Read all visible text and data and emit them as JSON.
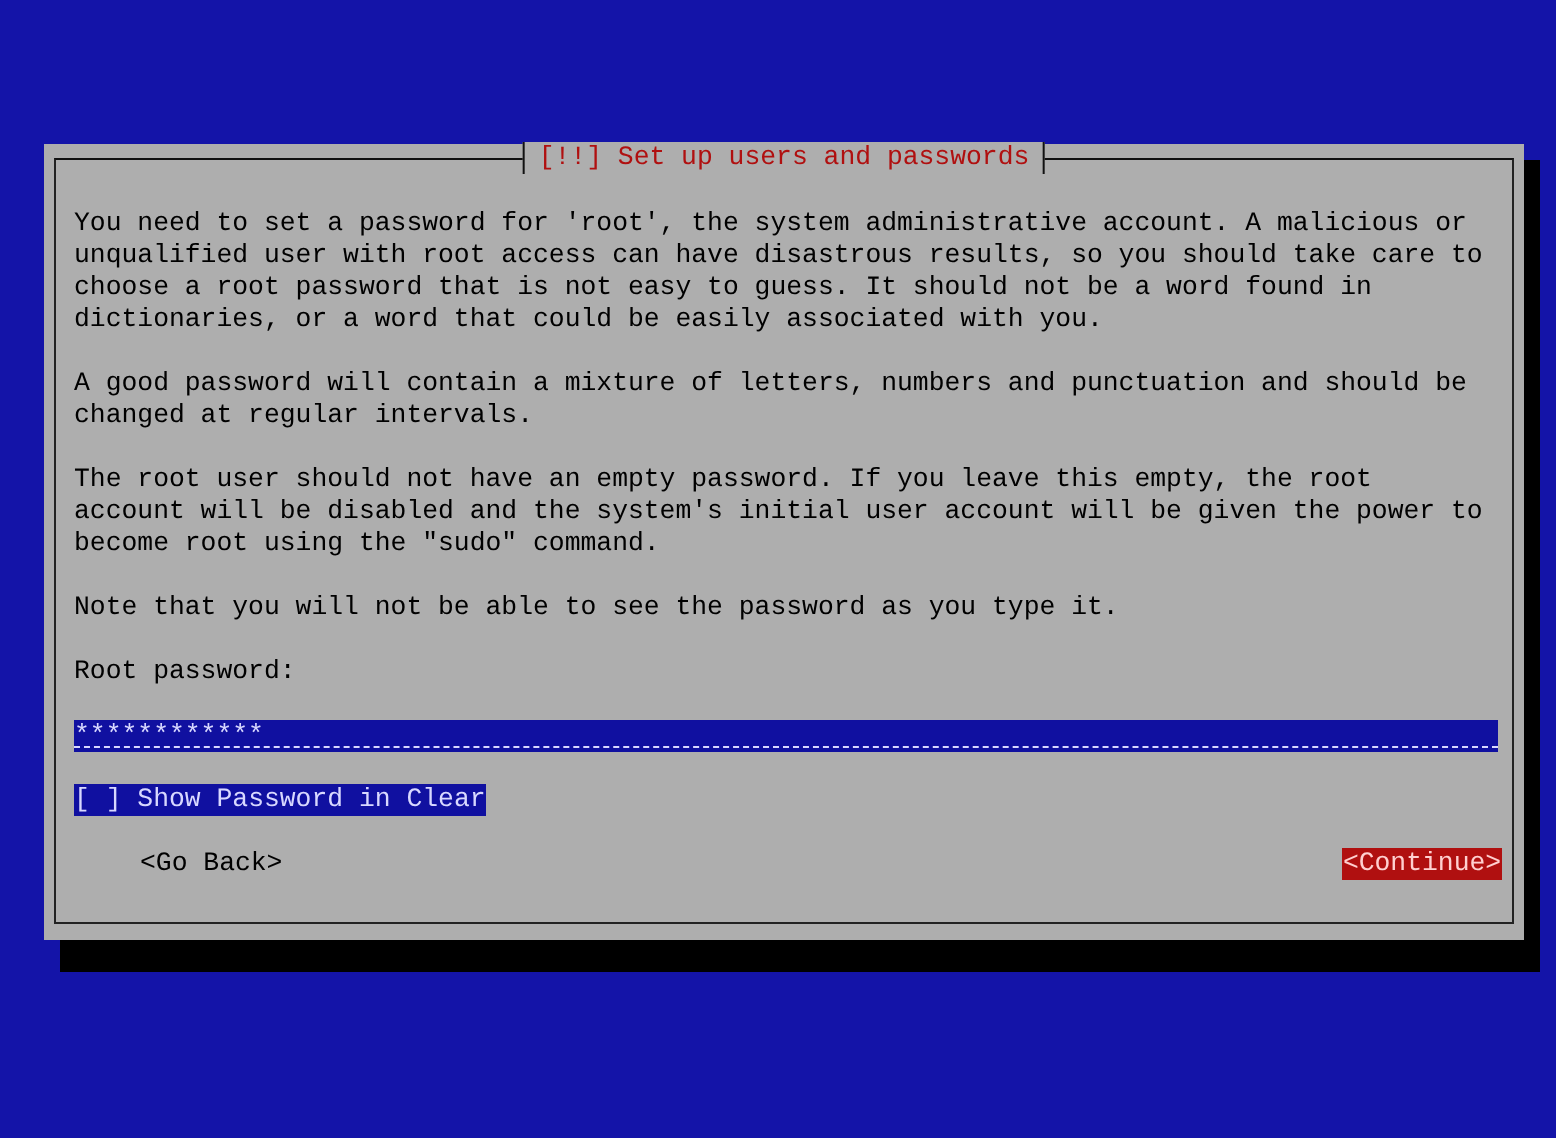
{
  "dialog": {
    "title": "[!!] Set up users and passwords",
    "paragraphs": [
      "You need to set a password for 'root', the system administrative account. A malicious or unqualified user with root access can have disastrous results, so you should take care to choose a root password that is not easy to guess. It should not be a word found in dictionaries, or a word that could be easily associated with you.",
      "A good password will contain a mixture of letters, numbers and punctuation and should be changed at regular intervals.",
      "The root user should not have an empty password. If you leave this empty, the root account will be disabled and the system's initial user account will be given the power to become root using the \"sudo\" command.",
      "Note that you will not be able to see the password as you type it."
    ],
    "field": {
      "label": "Root password:",
      "value": "************"
    },
    "checkbox": {
      "box_left": "[",
      "box_right": "]",
      "label": "Show Password in Clear",
      "checked": false,
      "focused": true
    },
    "buttons": [
      {
        "label": "<Go Back>",
        "selected": false
      },
      {
        "label": "<Continue>",
        "selected": true
      }
    ]
  }
}
